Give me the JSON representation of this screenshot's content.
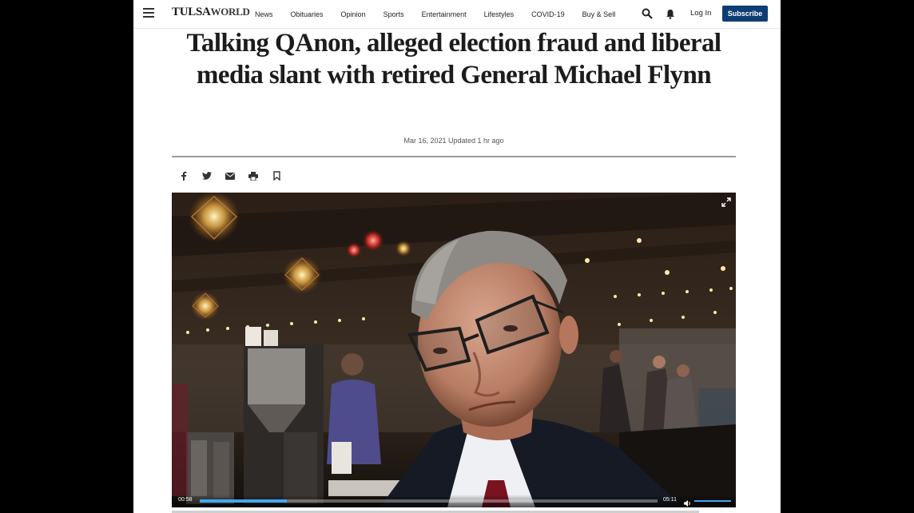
{
  "site": {
    "logo_part1": "TULSA",
    "logo_part2": "WORLD"
  },
  "nav": {
    "items": [
      "News",
      "Obituaries",
      "Opinion",
      "Sports",
      "Entertainment",
      "Lifestyles",
      "COVID-19",
      "Buy & Sell"
    ],
    "login_label": "Log In",
    "subscribe_label": "Subscribe",
    "icons": [
      "menu-icon",
      "search-icon",
      "bell-icon"
    ]
  },
  "article": {
    "headline": "Talking QAnon, alleged election fraud and liberal media slant with retired General Michael Flynn",
    "dateline": "Mar 16, 2021 Updated 1 hr ago",
    "share_icons": [
      "facebook-icon",
      "twitter-icon",
      "email-icon",
      "print-icon",
      "bookmark-icon"
    ]
  },
  "video": {
    "current_time": "00:58",
    "total_time": "05:11",
    "progress_fraction": 0.19,
    "volume_fraction": 1.0,
    "accent_color": "#3fa9f5"
  },
  "colors": {
    "subscribe_bg": "#0d3e73",
    "page_bg": "#ffffff",
    "outer_bg": "#000000"
  }
}
